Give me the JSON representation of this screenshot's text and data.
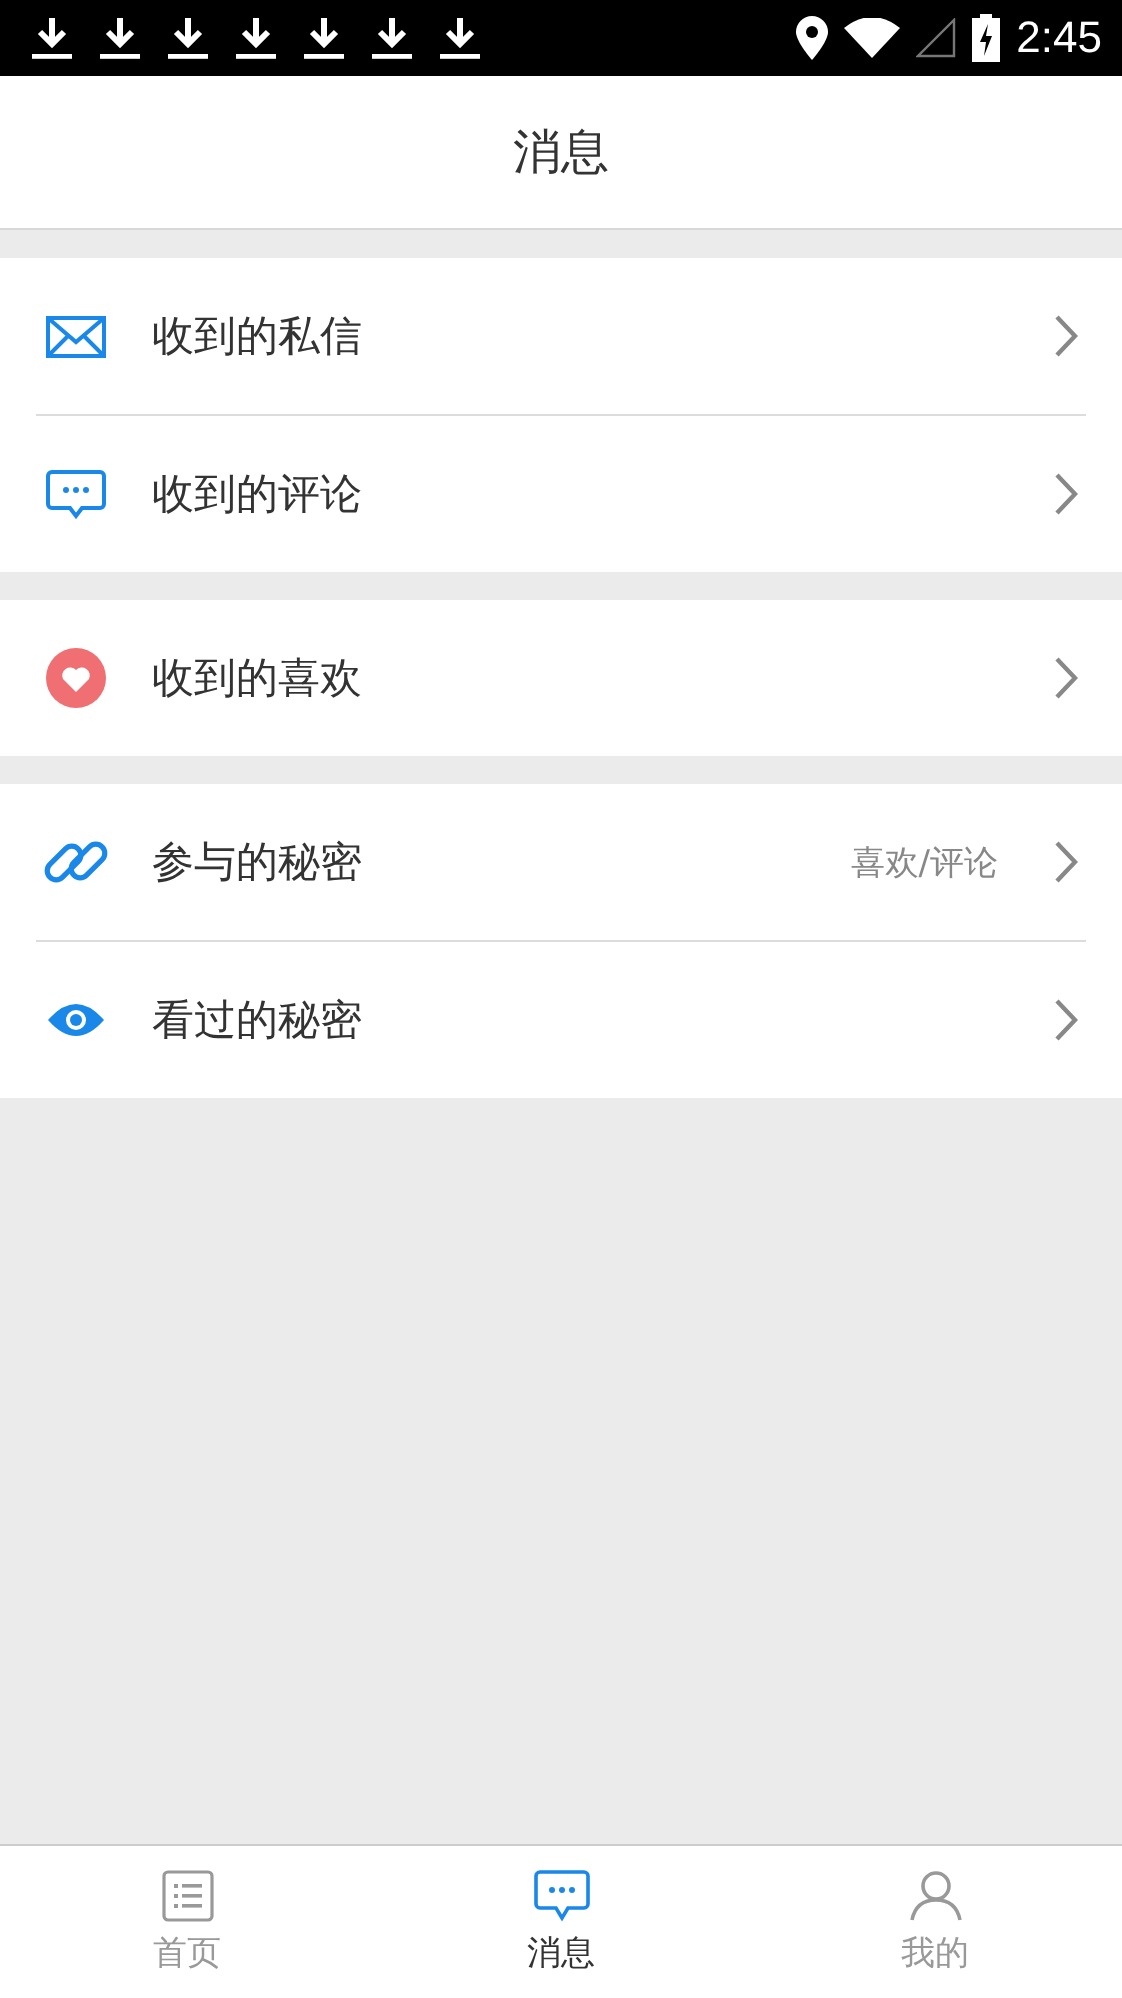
{
  "status_bar": {
    "time": "2:45"
  },
  "header": {
    "title": "消息"
  },
  "groups": [
    {
      "items": [
        {
          "kind": "mail",
          "label": "收到的私信"
        },
        {
          "kind": "comment",
          "label": "收到的评论"
        }
      ]
    },
    {
      "items": [
        {
          "kind": "heart",
          "label": "收到的喜欢"
        }
      ]
    },
    {
      "items": [
        {
          "kind": "link",
          "label": "参与的秘密",
          "detail": "喜欢/评论"
        },
        {
          "kind": "eye",
          "label": "看过的秘密"
        }
      ]
    }
  ],
  "tabs": [
    {
      "kind": "home",
      "label": "首页",
      "selected": false
    },
    {
      "kind": "messages",
      "label": "消息",
      "selected": true
    },
    {
      "kind": "profile",
      "label": "我的",
      "selected": false
    }
  ]
}
